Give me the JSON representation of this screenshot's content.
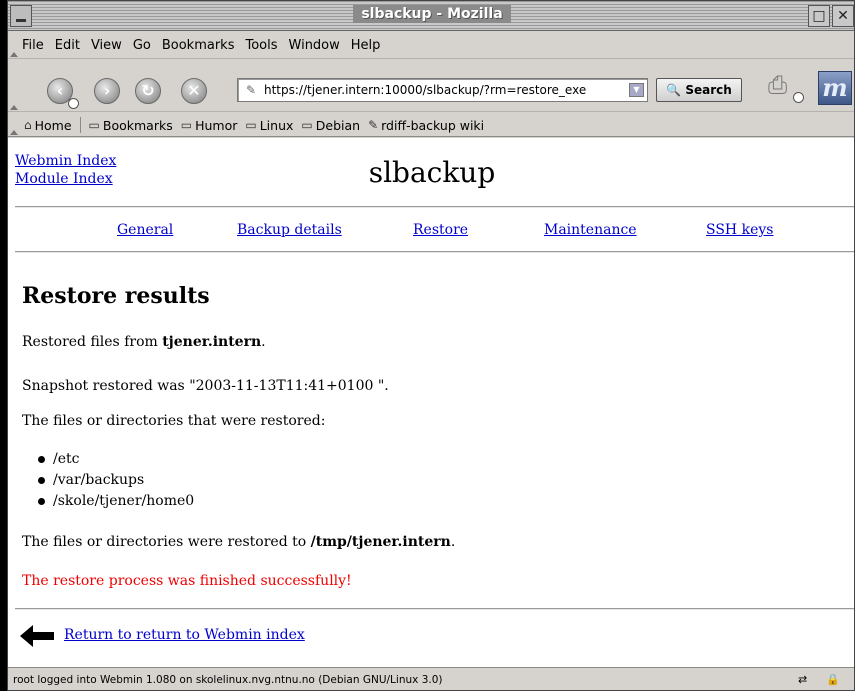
{
  "window": {
    "title": "slbackup - Mozilla"
  },
  "menu": [
    "File",
    "Edit",
    "View",
    "Go",
    "Bookmarks",
    "Tools",
    "Window",
    "Help"
  ],
  "nav": {
    "url": "https://tjener.intern:10000/slbackup/?rm=restore_exe",
    "search_label": "Search",
    "back_icon": "back-arrow-icon",
    "forward_icon": "forward-arrow-icon",
    "reload_icon": "reload-icon",
    "stop_icon": "stop-icon"
  },
  "bookmarks_bar": {
    "home": "Home",
    "items": [
      "Bookmarks",
      "Humor",
      "Linux",
      "Debian",
      "rdiff-backup wiki"
    ]
  },
  "page": {
    "webmin_index": "Webmin Index",
    "module_index": "Module Index",
    "title": "slbackup",
    "tabs": [
      "General",
      "Backup details",
      "Restore",
      "Maintenance",
      "SSH keys"
    ],
    "heading": "Restore results",
    "restored_from_prefix": "Restored files from ",
    "restored_from_host": "tjener.intern",
    "restored_from_suffix": ".",
    "snapshot_text": "Snapshot restored was \"2003-11-13T11:41+0100 \".",
    "files_intro": "The files or directories that were restored:",
    "files": [
      "/etc",
      "/var/backups",
      "/skole/tjener/home0"
    ],
    "restored_to_prefix": "The files or directories were restored to ",
    "restored_to_path": "/tmp/tjener.intern",
    "restored_to_suffix": ".",
    "success_message": "The restore process was finished successfully!",
    "return_link": "Return to return to Webmin index"
  },
  "status": {
    "text": "root logged into Webmin 1.080 on skolelinux.nvg.ntnu.no (Debian GNU/Linux 3.0)"
  },
  "colors": {
    "link": "#0000cc",
    "success": "#ee0000"
  }
}
